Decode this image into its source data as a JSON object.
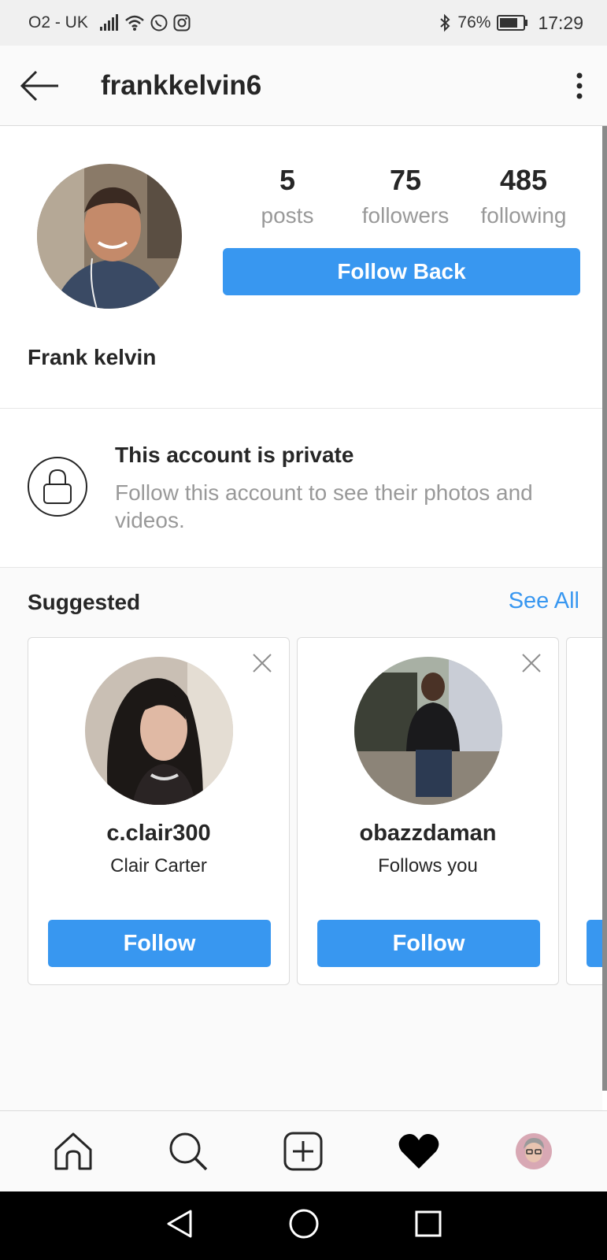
{
  "status_bar": {
    "carrier": "O2 - UK",
    "battery": "76%",
    "time": "17:29"
  },
  "header": {
    "username": "frankkelvin6"
  },
  "profile": {
    "stats": [
      {
        "value": "5",
        "label": "posts"
      },
      {
        "value": "75",
        "label": "followers"
      },
      {
        "value": "485",
        "label": "following"
      }
    ],
    "follow_back_label": "Follow Back",
    "full_name": "Frank kelvin"
  },
  "private_notice": {
    "title": "This account is private",
    "subtitle": "Follow this account to see their photos and videos."
  },
  "suggested": {
    "title": "Suggested",
    "see_all": "See All",
    "cards": [
      {
        "username": "c.clair300",
        "subtitle": "Clair Carter",
        "button": "Follow"
      },
      {
        "username": "obazzdaman",
        "subtitle": "Follows you",
        "button": "Follow"
      }
    ]
  },
  "colors": {
    "accent": "#3897f0",
    "text": "#262626",
    "muted": "#999999"
  },
  "icons": {
    "back": "arrow-left-icon",
    "more": "more-vertical-icon",
    "lock": "lock-icon",
    "close": "close-icon",
    "home": "home-icon",
    "search": "search-icon",
    "add": "add-post-icon",
    "activity": "heart-icon",
    "profile": "profile-avatar"
  }
}
